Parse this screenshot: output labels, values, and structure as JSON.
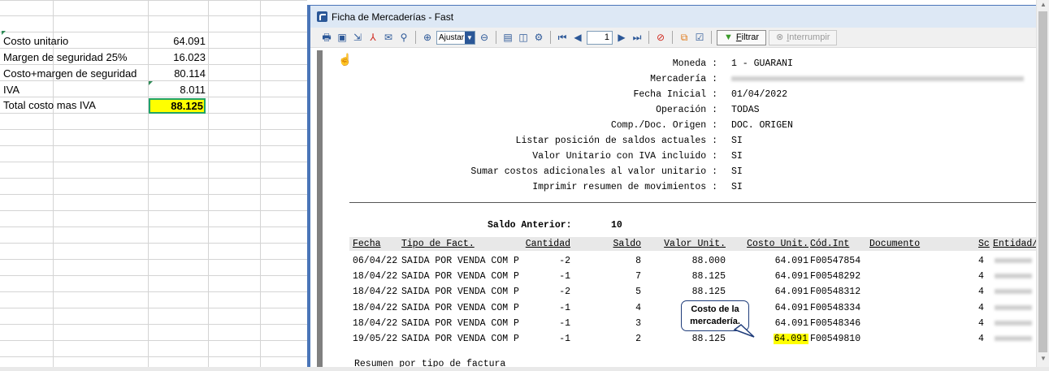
{
  "spreadsheet": {
    "rows": [
      {
        "label": "Costo unitario",
        "value": "64.091"
      },
      {
        "label": "Margen de seguridad 25%",
        "value": "16.023"
      },
      {
        "label": "Costo+margen de seguridad",
        "value": "80.114"
      },
      {
        "label": "IVA",
        "value": "8.011"
      },
      {
        "label": "Total costo mas IVA",
        "value": "88.125",
        "highlighted": true
      }
    ],
    "highlight_color": "#ffff00",
    "selection_color": "#21a366"
  },
  "window": {
    "title": "Ficha de Mercaderías - Fast",
    "title_icon": "app-icon"
  },
  "toolbar": {
    "zoom_label": "Ajustar a",
    "page_number": "1",
    "filtrar_key": "F",
    "filtrar_rest": "iltrar",
    "interrumpir_key": "I",
    "interrumpir_rest": "nterrumpir",
    "icons": [
      "print-icon",
      "save-icon",
      "export-icon",
      "pdf-icon",
      "email-icon",
      "find-icon",
      "zoom-in-icon",
      "zoom-out-icon",
      "page-setup-icon",
      "layout-icon",
      "settings-icon",
      "first-page-icon",
      "prev-page-icon",
      "next-page-icon",
      "last-page-icon",
      "stop-icon",
      "copy-icon",
      "options-icon",
      "filter-icon",
      "interrupt-icon"
    ]
  },
  "report": {
    "params": [
      {
        "label": "Moneda :",
        "value": "1 - GUARANI"
      },
      {
        "label": "Mercadería :",
        "value": ""
      },
      {
        "label": "Fecha Inicial :",
        "value": "01/04/2022"
      },
      {
        "label": "Operación :",
        "value": "TODAS"
      },
      {
        "label": "Comp./Doc. Origen :",
        "value": "DOC. ORIGEN"
      },
      {
        "label": "Listar posición de saldos actuales :",
        "value": "SI"
      },
      {
        "label": "Valor Unitario con IVA incluido :",
        "value": "SI"
      },
      {
        "label": "Sumar costos adicionales al valor unitario :",
        "value": "SI"
      },
      {
        "label": "Imprimir resumen de movimientos :",
        "value": "SI"
      }
    ],
    "saldo_anterior_label": "Saldo Anterior:",
    "saldo_anterior_value": "10",
    "columns": {
      "fecha": "Fecha",
      "tipo": "Tipo de Fact.",
      "cantidad": "Cantidad",
      "saldo": "Saldo",
      "valor_unit": "Valor Unit.",
      "costo_unit": "Costo Unit.",
      "cod_int": "Cód.Int",
      "documento": "Documento",
      "sc": "Sc",
      "entidad": "Entidad/:"
    },
    "rows": [
      {
        "fecha": "06/04/22",
        "tipo": "SAIDA POR VENDA COM P",
        "cantidad": "-2",
        "saldo": "8",
        "valor_unit": "88.000",
        "costo_unit": "64.091",
        "cod_int": "F00547854",
        "sc": "4"
      },
      {
        "fecha": "18/04/22",
        "tipo": "SAIDA POR VENDA COM P",
        "cantidad": "-1",
        "saldo": "7",
        "valor_unit": "88.125",
        "costo_unit": "64.091",
        "cod_int": "F00548292",
        "sc": "4"
      },
      {
        "fecha": "18/04/22",
        "tipo": "SAIDA POR VENDA COM P",
        "cantidad": "-2",
        "saldo": "5",
        "valor_unit": "88.125",
        "costo_unit": "64.091",
        "cod_int": "F00548312",
        "sc": "4"
      },
      {
        "fecha": "18/04/22",
        "tipo": "SAIDA POR VENDA COM P",
        "cantidad": "-1",
        "saldo": "4",
        "valor_unit": "",
        "costo_unit": "64.091",
        "cod_int": "F00548334",
        "sc": "4"
      },
      {
        "fecha": "18/04/22",
        "tipo": "SAIDA POR VENDA COM P",
        "cantidad": "-1",
        "saldo": "3",
        "valor_unit": "",
        "costo_unit": "64.091",
        "cod_int": "F00548346",
        "sc": "4"
      },
      {
        "fecha": "19/05/22",
        "tipo": "SAIDA POR VENDA COM P",
        "cantidad": "-1",
        "saldo": "2",
        "valor_unit": "88.125",
        "costo_unit": "64.091",
        "cod_int": "F00549810",
        "sc": "4",
        "highlight_costo": true
      }
    ],
    "callout": {
      "line1": "Costo de la",
      "line2": "mercadería."
    },
    "resumen": "Resumen por tipo de factura"
  }
}
